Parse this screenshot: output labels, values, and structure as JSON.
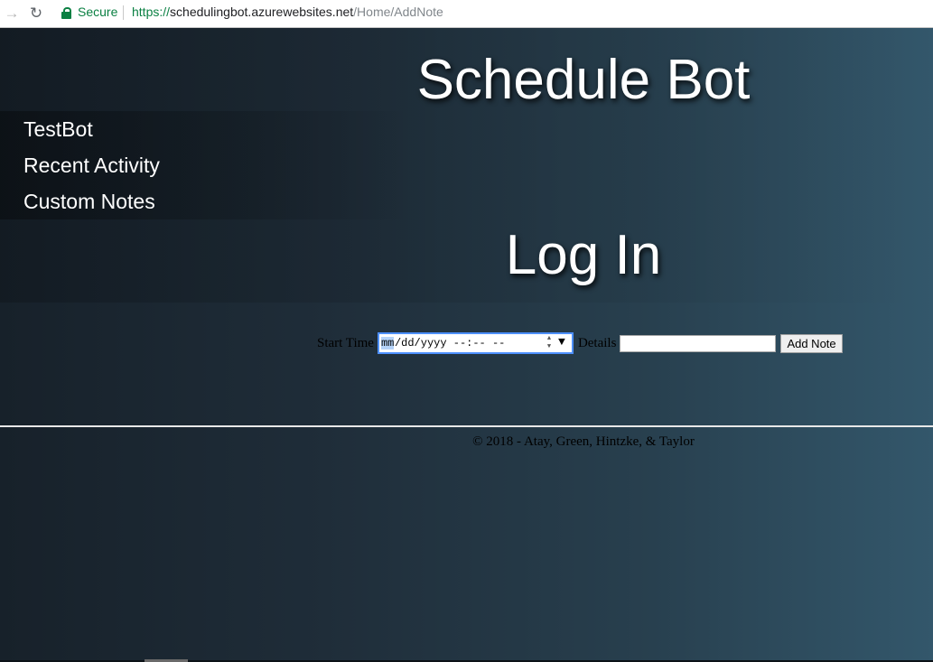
{
  "browser": {
    "back_icon": "arrow-left-icon",
    "reload_icon": "reload-icon",
    "lock_icon": "lock-icon",
    "secure_label": "Secure",
    "url_scheme": "https://",
    "url_host": "schedulingbot.azurewebsites.net",
    "url_path": "/Home/AddNote",
    "secure_color": "#0b8043"
  },
  "header": {
    "site_title": "Schedule Bot",
    "login_heading": "Log In"
  },
  "sidebar": {
    "items": [
      {
        "label": "TestBot"
      },
      {
        "label": "Recent Activity"
      },
      {
        "label": "Custom Notes"
      }
    ]
  },
  "form": {
    "start_label": "Start Time",
    "datetime_month": "mm",
    "datetime_rest": "/dd/yyyy --:-- --",
    "details_label": "Details",
    "details_value": "",
    "add_button": "Add Note"
  },
  "footer": {
    "copyright": "© 2018 - Atay, Green, Hintzke, & Taylor"
  }
}
